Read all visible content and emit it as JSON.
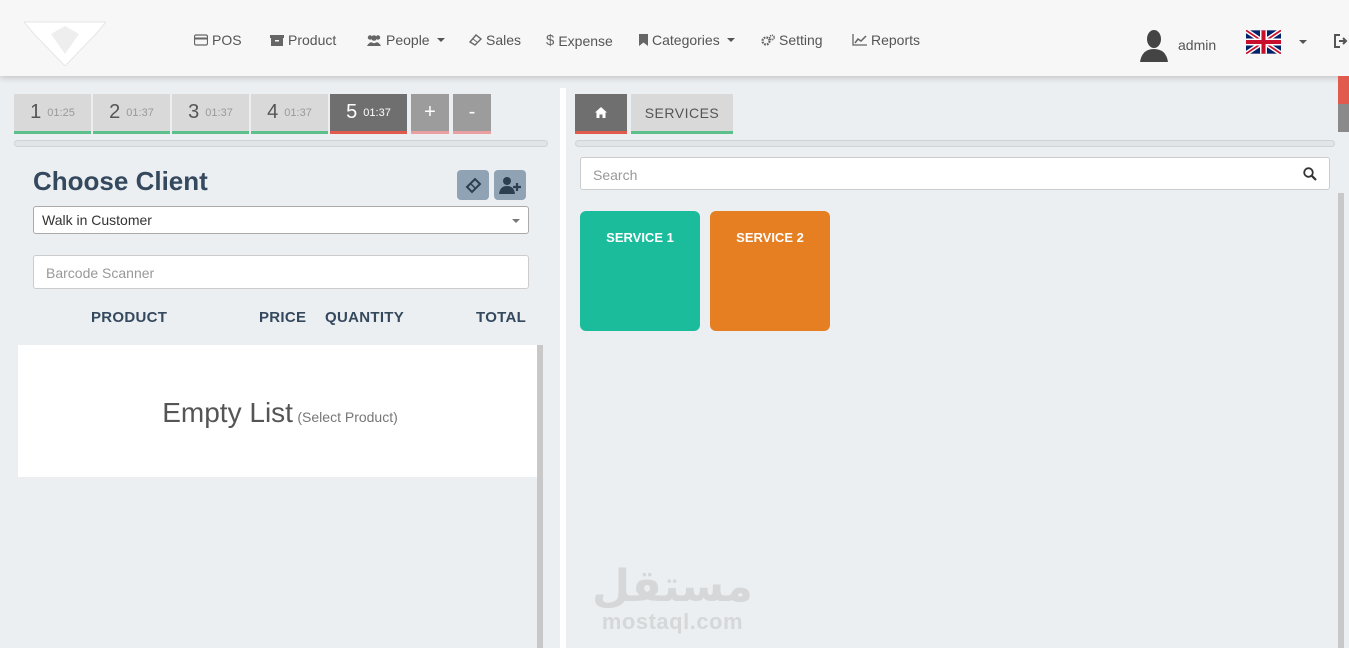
{
  "nav": {
    "items": [
      {
        "label": "POS",
        "icon": "credit-card-icon"
      },
      {
        "label": "Product",
        "icon": "archive-icon"
      },
      {
        "label": "People",
        "icon": "users-icon",
        "dropdown": true
      },
      {
        "label": "Sales",
        "icon": "ticket-icon"
      },
      {
        "label": "Expense",
        "icon": "dollar-icon"
      },
      {
        "label": "Categories",
        "icon": "bookmark-icon",
        "dropdown": true
      },
      {
        "label": "Setting",
        "icon": "gears-icon"
      },
      {
        "label": "Reports",
        "icon": "line-chart-icon"
      }
    ],
    "user": "admin",
    "language_icon": "uk-flag-icon"
  },
  "orders": {
    "tabs": [
      {
        "num": "1",
        "time": "01:25"
      },
      {
        "num": "2",
        "time": "01:37"
      },
      {
        "num": "3",
        "time": "01:37"
      },
      {
        "num": "4",
        "time": "01:37"
      },
      {
        "num": "5",
        "time": "01:37",
        "active": true
      }
    ],
    "add_label": "+",
    "remove_label": "-"
  },
  "client": {
    "title": "Choose Client",
    "selected": "Walk in Customer",
    "barcode_placeholder": "Barcode Scanner"
  },
  "table": {
    "headers": [
      "PRODUCT",
      "PRICE",
      "QUANTITY",
      "TOTAL"
    ],
    "empty_main": "Empty List",
    "empty_hint": "(Select Product)"
  },
  "catalog": {
    "tab_label": "SERVICES",
    "search_placeholder": "Search",
    "items": [
      {
        "label": "SERVICE 1",
        "color": "#1abc9c"
      },
      {
        "label": "SERVICE 2",
        "color": "#e67e22"
      }
    ]
  },
  "watermark": {
    "arabic": "مستقل",
    "latin": "mostaql.com"
  },
  "colors": {
    "accent_red": "#e05a4e",
    "accent_green": "#5cc08b",
    "title": "#34495e"
  }
}
